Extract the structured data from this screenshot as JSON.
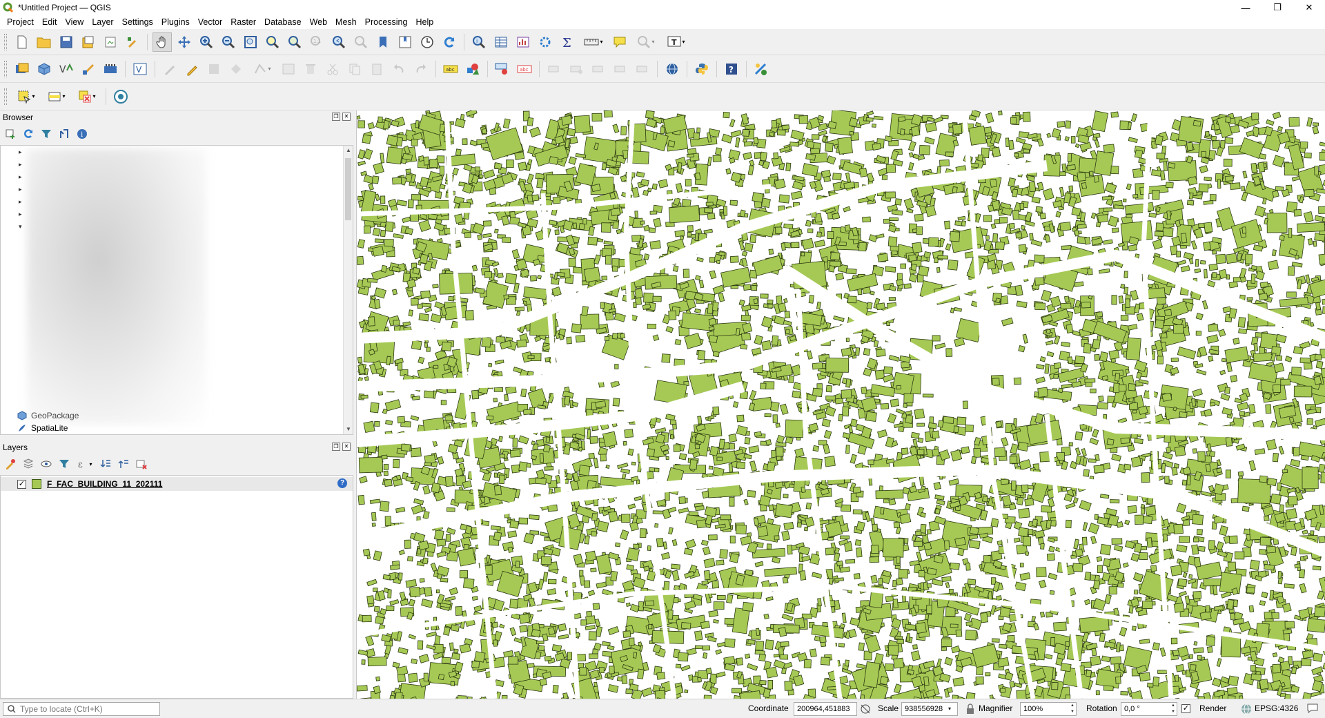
{
  "window": {
    "title": "*Untitled Project — QGIS",
    "controls": [
      "—",
      "❐",
      "✕"
    ]
  },
  "menubar": {
    "items": [
      "Project",
      "Edit",
      "View",
      "Layer",
      "Settings",
      "Plugins",
      "Vector",
      "Raster",
      "Database",
      "Web",
      "Mesh",
      "Processing",
      "Help"
    ]
  },
  "toolbars": {
    "row1": [
      "new-project-icon",
      "open-project-icon",
      "save-project-icon",
      "save-as-icon",
      "print-layout-icon",
      "style-manager-icon",
      "pan-icon",
      "pan-to-selection-icon",
      "zoom-in-icon",
      "zoom-out-icon",
      "zoom-full-icon",
      "zoom-to-selection-icon",
      "zoom-to-layer-icon",
      "zoom-native-icon",
      "zoom-last-icon",
      "zoom-next-icon",
      "new-bookmark-icon",
      "show-bookmarks-icon",
      "temporal-controller-icon",
      "refresh-icon",
      "identify-icon",
      "attribute-table-icon",
      "statistics-icon",
      "field-calculator-icon",
      "sum-icon",
      "measure-icon",
      "map-tips-icon",
      "annotation-icon",
      "text-annotation-icon"
    ],
    "row2": [
      "data-source-manager-icon",
      "new-geopackage-icon",
      "new-shapefile-icon",
      "new-temp-layer-icon",
      "new-spatialite-icon",
      "new-virtual-layer-icon",
      "digitize-icon",
      "toggle-edit-icon",
      "save-edits-icon",
      "add-feature-icon",
      "vertex-tool-icon",
      "modify-attributes-icon",
      "delete-selected-icon",
      "cut-features-icon",
      "copy-features-icon",
      "paste-features-icon",
      "undo-icon",
      "redo-icon",
      "label-tool-icon",
      "label-style-icon",
      "pin-labels-icon",
      "show-hide-labels-icon",
      "move-label-icon",
      "rotate-label-icon",
      "change-label-icon",
      "python-console-icon",
      "help-icon",
      "georeferencer-icon"
    ],
    "row3": [
      "select-features-icon",
      "select-by-expression-icon",
      "deselect-icon",
      "run-process-icon"
    ]
  },
  "browser": {
    "title": "Browser",
    "tools": [
      "add-selected-icon",
      "refresh-icon",
      "filter-icon",
      "collapse-all-icon",
      "properties-icon"
    ],
    "visible_items": [
      "GeoPackage",
      "SpatiaLite"
    ]
  },
  "layers": {
    "title": "Layers",
    "tools": [
      "style-icon",
      "add-group-icon",
      "manage-visibility-icon",
      "filter-legend-icon",
      "filter-expression-icon",
      "expand-all-icon",
      "collapse-all-icon",
      "remove-layer-icon"
    ],
    "items": [
      {
        "name": "F_FAC_BUILDING_11_202111",
        "checked": true,
        "color": "#a6c955"
      }
    ]
  },
  "map": {
    "building_fill": "#a6c955",
    "building_stroke": "#2d3a12",
    "background": "#ffffff"
  },
  "statusbar": {
    "locate_placeholder": "Type to locate (Ctrl+K)",
    "coordinate_label": "Coordinate",
    "coordinate_value": "200964,451883",
    "scale_label": "Scale",
    "scale_value": "938556928",
    "magnifier_label": "Magnifier",
    "magnifier_value": "100%",
    "rotation_label": "Rotation",
    "rotation_value": "0,0 °",
    "render_label": "Render",
    "crs": "EPSG:4326"
  }
}
